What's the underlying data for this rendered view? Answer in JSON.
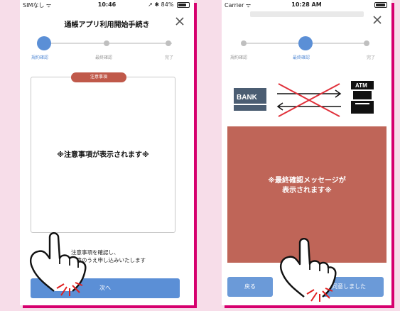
{
  "left_screen": {
    "status": {
      "carrier": "SIMなし ᯤ",
      "time": "10:46",
      "right": "↗ ✱ 84%"
    },
    "title": "通帳アプリ利用開始手続き",
    "steps": [
      "規約確認",
      "最終確認",
      "完了"
    ],
    "notice_tab": "注意事項",
    "notice_text": "※注意事項が表示されます※",
    "consent_line1": "注意事項を確認し、",
    "consent_line2": "同意のうえ申し込みいたします",
    "next_button": "次へ"
  },
  "right_screen": {
    "status": {
      "carrier": "Carrier ᯤ",
      "time": "10:28 AM"
    },
    "steps": [
      "規約確認",
      "最終確認",
      "完了"
    ],
    "bank_label": "BANK",
    "atm_label": "ATM",
    "message_line1": "※最終確認メッセージが",
    "message_line2": "表示されます※",
    "back_button": "戻る",
    "agree_button": "同意しました"
  },
  "colors": {
    "accent_blue": "#5b8fd6",
    "notice_red": "#c0594a",
    "message_red": "#bf6558",
    "frame_pink": "#d6006e",
    "background_pink": "#f7dde9"
  },
  "icons": [
    "close-icon",
    "wifi-icon",
    "battery-icon",
    "bank-icon",
    "atm-icon",
    "transfer-arrows-icon",
    "cross-icon",
    "tap-hand-icon"
  ]
}
